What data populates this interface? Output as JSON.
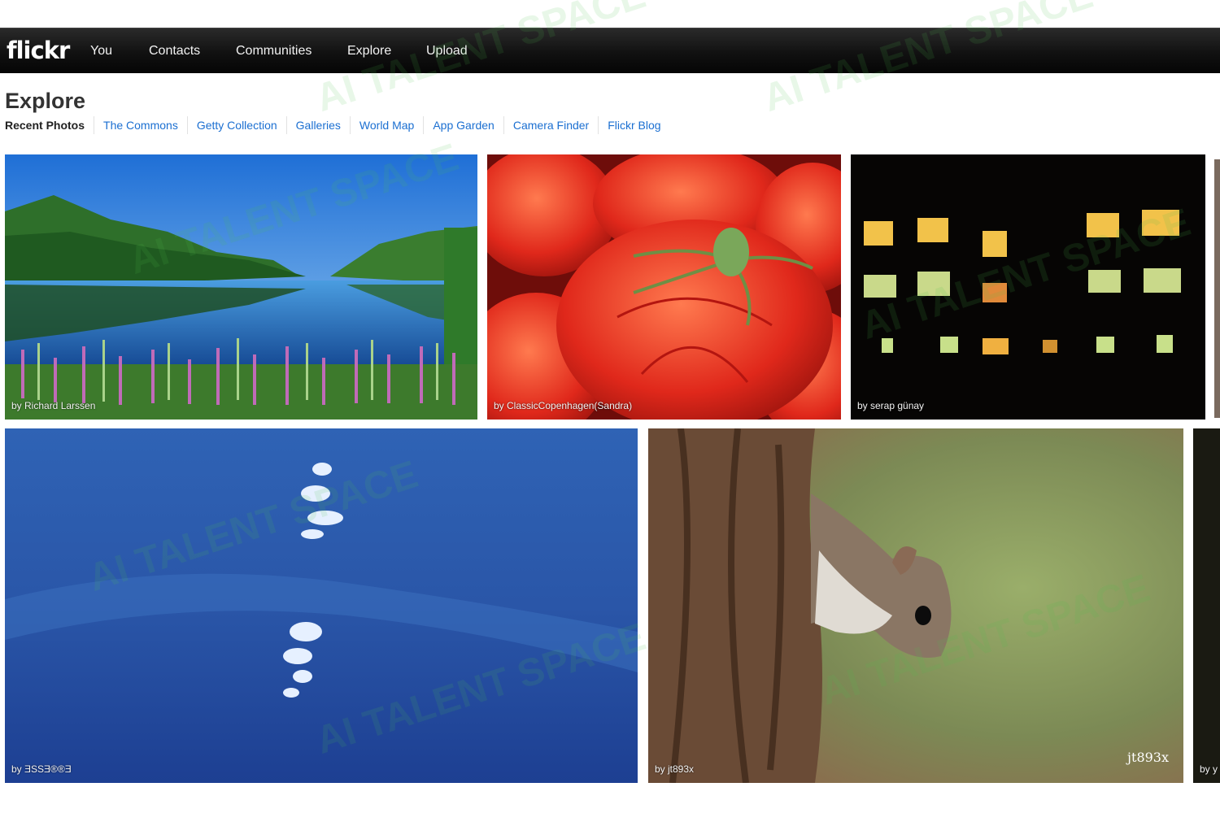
{
  "header": {
    "logo": "flickr",
    "nav": [
      "You",
      "Contacts",
      "Communities",
      "Explore",
      "Upload"
    ]
  },
  "page": {
    "title": "Explore",
    "subnav": [
      "Recent Photos",
      "The Commons",
      "Getty Collection",
      "Galleries",
      "World Map",
      "App Garden",
      "Camera Finder",
      "Flickr Blog"
    ]
  },
  "photos": [
    {
      "credit": "by Richard Larssen",
      "subject": "mountain lake with pink flowers"
    },
    {
      "credit": "by ClassicCopenhagen(Sandra)",
      "subject": "red tomatoes"
    },
    {
      "credit": "by serap günay",
      "subject": "lit windows at night"
    },
    {
      "credit": "by ƎSSƎ®®Ǝ",
      "subject": "moonlight on water"
    },
    {
      "credit": "by jt893x",
      "subject": "squirrel on tree",
      "signature": "jt893x"
    },
    {
      "credit": "by y",
      "subject": "partial photo"
    }
  ],
  "watermark": {
    "text": "AI TALENT SPACE"
  },
  "colors": {
    "link": "#1b6fd1",
    "topbar": "#111111"
  }
}
